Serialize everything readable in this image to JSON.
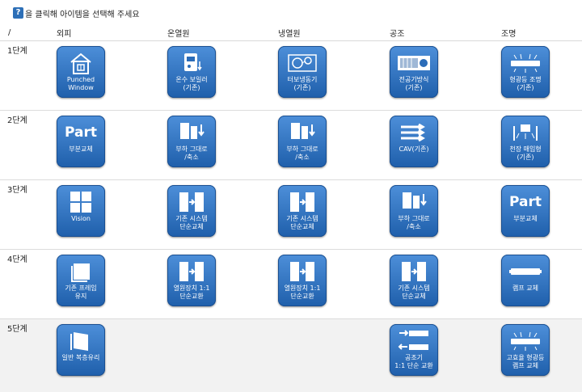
{
  "help": {
    "icon": "?",
    "text": "을 클릭해 아이템을 선택해 주세요"
  },
  "header": {
    "corner": "/",
    "columns": [
      "외피",
      "온열원",
      "냉열원",
      "공조",
      "조명"
    ]
  },
  "rows": [
    {
      "label": "1단계"
    },
    {
      "label": "2단계"
    },
    {
      "label": "3단계"
    },
    {
      "label": "4단계"
    },
    {
      "label": "5단계"
    }
  ],
  "tiles": {
    "r1": [
      {
        "caption": "Punched\nWindow",
        "icon": "house-window-icon"
      },
      {
        "caption": "온수 보일러\n(기존)",
        "icon": "boiler-icon"
      },
      {
        "caption": "터보냉동기\n(기존)",
        "icon": "turbo-chiller-icon"
      },
      {
        "caption": "전공기방식\n(기존)",
        "icon": "air-handler-icon"
      },
      {
        "caption": "형광등 조명\n(기존)",
        "icon": "fluorescent-lamp-icon"
      }
    ],
    "r2": [
      {
        "caption": "부분교체",
        "big": "Part",
        "icon": "part-text-icon"
      },
      {
        "caption": "부하 그대로\n/축소",
        "icon": "load-reduce-icon"
      },
      {
        "caption": "부하 그대로\n/축소",
        "icon": "load-reduce-icon"
      },
      {
        "caption": "CAV(기존)",
        "icon": "cav-arrows-icon"
      },
      {
        "caption": "천장 매입형\n(기존)",
        "icon": "ceiling-light-icon"
      }
    ],
    "r3": [
      {
        "caption": "Vision",
        "icon": "window-grid-icon"
      },
      {
        "caption": "기존 시스템\n단순교체",
        "icon": "system-replace-icon"
      },
      {
        "caption": "기존 시스템\n단순교체",
        "icon": "system-replace-icon"
      },
      {
        "caption": "부하 그대로\n/축소",
        "icon": "load-reduce-icon"
      },
      {
        "caption": "부분교체",
        "big": "Part",
        "icon": "part-text-icon"
      }
    ],
    "r4": [
      {
        "caption": "기존 프레임\n유지",
        "icon": "frame-icon"
      },
      {
        "caption": "열원장치 1:1\n단순교환",
        "icon": "system-replace-icon"
      },
      {
        "caption": "열원장치 1:1\n단순교환",
        "icon": "system-replace-icon"
      },
      {
        "caption": "기존 시스템\n단순교체",
        "icon": "system-replace-icon"
      },
      {
        "caption": "램프 교체",
        "icon": "lamp-tube-icon"
      }
    ],
    "r5": [
      {
        "caption": "일반 복층유리",
        "icon": "double-glazing-icon"
      },
      {
        "caption": "공조기\n1:1 단순 교환",
        "icon": "ahu-exchange-icon"
      },
      {
        "caption": "고효율 형광등\n램프 교체",
        "icon": "efficient-lamp-icon"
      }
    ]
  }
}
